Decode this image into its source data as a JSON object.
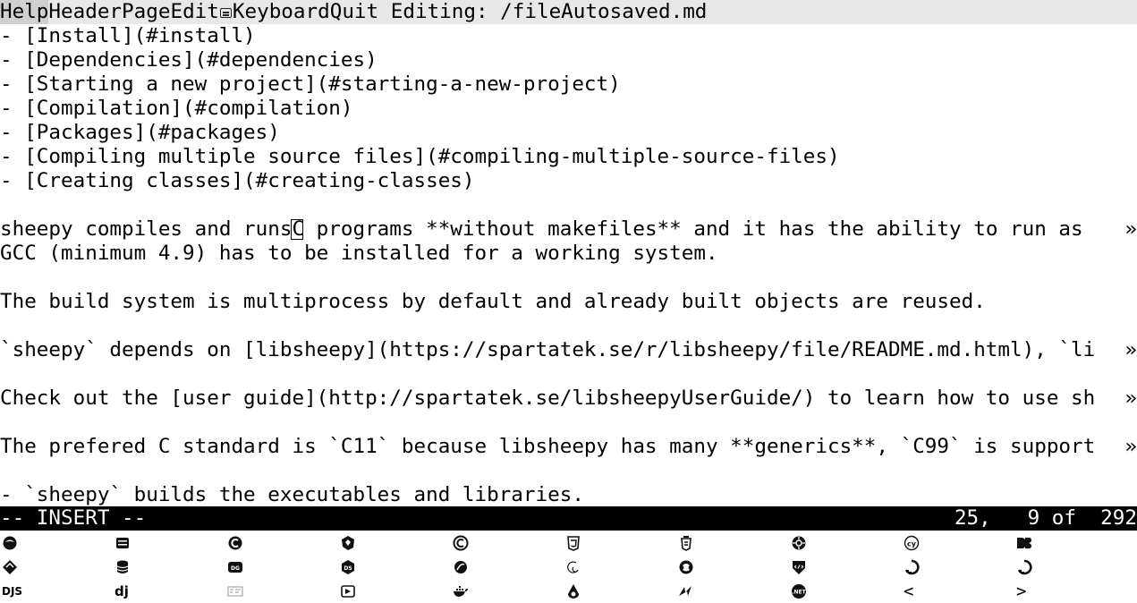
{
  "menubar": {
    "items": [
      "Help",
      "Header",
      "Page",
      "Edit",
      "Keyboard",
      "Quit"
    ],
    "title": " Editing: /fileAutosaved.md"
  },
  "editor": {
    "lines": [
      "- [Install](#install)",
      "- [Dependencies](#dependencies)",
      "- [Starting a new project](#starting-a-new-project)",
      "- [Compilation](#compilation)",
      "- [Packages](#packages)",
      "- [Compiling multiple source files](#compiling-multiple-source-files)",
      "- [Creating classes](#creating-classes)",
      "",
      "",
      "GCC (minimum 4.9) has to be installed for a working system.",
      "",
      "The build system is multiprocess by default and already built objects are reused.",
      "",
      "`sheepy` depends on [libsheepy](https://spartatek.se/r/libsheepy/file/README.md.html), `li",
      "",
      "Check out the [user guide](http://spartatek.se/libsheepyUserGuide/) to learn how to use sh",
      "",
      "The prefered C standard is `C11` because libsheepy has many **generics**, `C99` is support",
      "",
      "- `sheepy` builds the executables and libraries."
    ],
    "cursor_line_before": "sheepy compiles and runs",
    "cursor_line_after": "C programs **without makefiles** and it has the ability to run as",
    "truncation_marker": "»"
  },
  "status": {
    "mode": "-- INSERT --",
    "position": "25,   9 of  292"
  },
  "icons": [
    [
      "icon-1",
      "icon-2",
      "icon-3",
      "icon-4",
      "icon-5",
      "html5-icon",
      "icon-7",
      "icon-8",
      "copyleft-icon",
      "d3-icon"
    ],
    [
      "icon-11",
      "database-icon",
      "icon-13",
      "icon-14",
      "icon-15",
      "icon-16",
      "icon-17",
      "icon-18",
      "icon-19",
      "icon-20"
    ],
    [
      "djs-icon",
      "dj-icon",
      "icon-23",
      "icon-24",
      "docker-icon",
      "icon-26",
      "icon-27",
      "dotnet-icon",
      "prev-page-icon",
      "next-page-icon"
    ]
  ],
  "icon_text": {
    "djs": "DJS",
    "dj": "dj",
    "prev": "<",
    "next": ">"
  }
}
